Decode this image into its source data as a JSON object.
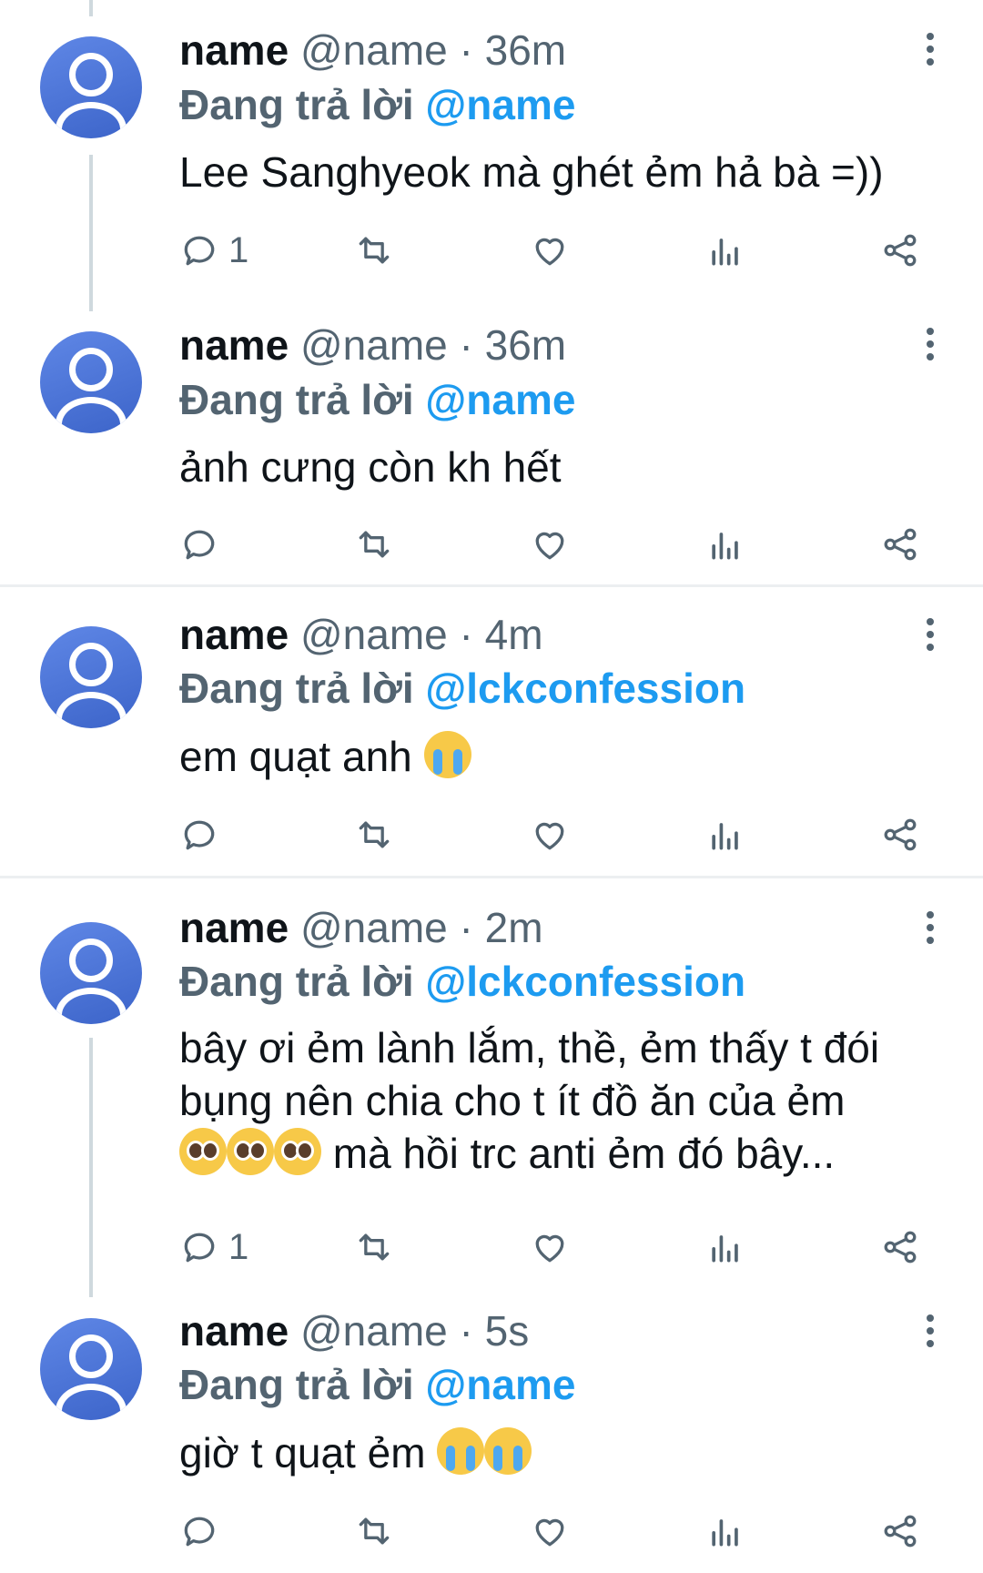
{
  "tweets": [
    {
      "name": "name",
      "handle": "@name",
      "sep": "·",
      "time": "36m",
      "reply_prefix": "Đang trả lời",
      "reply_to": "@name",
      "text": "Lee Sanghyeok mà ghét ẻm hả bà =))",
      "reply_count": "1"
    },
    {
      "name": "name",
      "handle": "@name",
      "sep": "·",
      "time": "36m",
      "reply_prefix": "Đang trả lời",
      "reply_to": "@name",
      "text": "ảnh cưng còn kh hết",
      "reply_count": ""
    },
    {
      "name": "name",
      "handle": "@name",
      "sep": "·",
      "time": "4m",
      "reply_prefix": "Đang trả lời",
      "reply_to": "@lckconfession",
      "text": "em quạt anh",
      "emoji": "loudly-crying-face",
      "reply_count": ""
    },
    {
      "name": "name",
      "handle": "@name",
      "sep": "·",
      "time": "2m",
      "reply_prefix": "Đang trả lời",
      "reply_to": "@lckconfession",
      "text_line1": "bây ơi ẻm lành lắm, thề, ẻm thấy t đói",
      "text_line2": "bụng nên chia cho t ít đồ ăn của ẻm",
      "text_line3": "mà hồi trc anti ẻm đó bây...",
      "emoji": "pleading-face",
      "reply_count": "1"
    },
    {
      "name": "name",
      "handle": "@name",
      "sep": "·",
      "time": "5s",
      "reply_prefix": "Đang trả lời",
      "reply_to": "@name",
      "text": "giờ t quạt ẻm",
      "emoji": "loudly-crying-face",
      "reply_count": ""
    }
  ],
  "icons": [
    "reply-icon",
    "retweet-icon",
    "like-icon",
    "stats-icon",
    "share-icon",
    "more-icon",
    "avatar-icon"
  ],
  "colors": {
    "accent": "#1d9bf0",
    "text": "#0f1419",
    "secondary": "#536471",
    "avatar": "#4a72d8"
  }
}
